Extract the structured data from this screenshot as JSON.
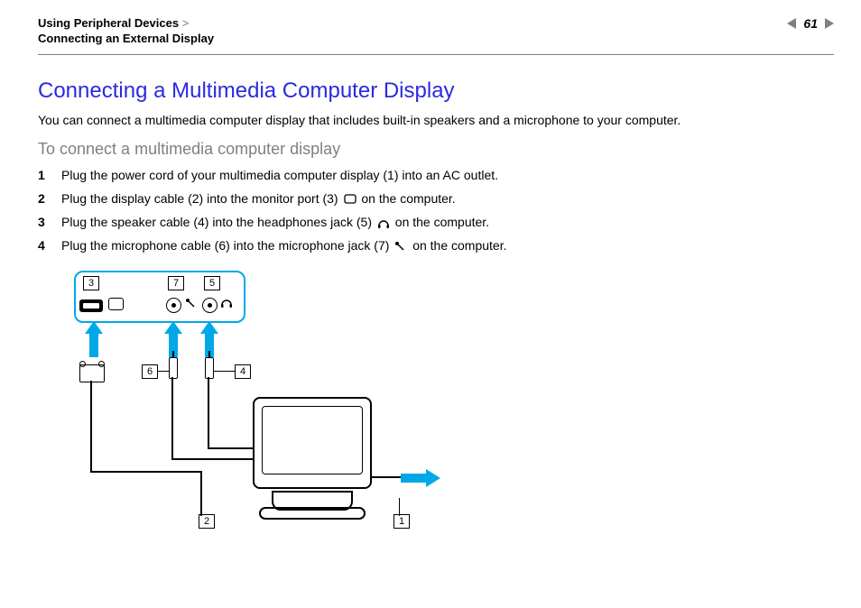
{
  "header": {
    "breadcrumb_top": "Using Peripheral Devices",
    "breadcrumb_sep": ">",
    "breadcrumb_sub": "Connecting an External Display",
    "page_number": "61"
  },
  "title": "Connecting a Multimedia Computer Display",
  "intro": "You can connect a multimedia computer display that includes built-in speakers and a microphone to your computer.",
  "subtitle": "To connect a multimedia computer display",
  "steps": [
    {
      "n": "1",
      "pre": "Plug the power cord of your multimedia computer display (1) into an AC outlet.",
      "icon": null,
      "post": ""
    },
    {
      "n": "2",
      "pre": "Plug the display cable (2) into the monitor port (3) ",
      "icon": "monitor",
      "post": " on the computer."
    },
    {
      "n": "3",
      "pre": "Plug the speaker cable (4) into the headphones jack (5) ",
      "icon": "headphones",
      "post": " on the computer."
    },
    {
      "n": "4",
      "pre": "Plug the microphone cable (6) into the microphone jack (7) ",
      "icon": "microphone",
      "post": " on the computer."
    }
  ],
  "callouts": {
    "b1": "1",
    "b2": "2",
    "b3": "3",
    "b4": "4",
    "b5": "5",
    "b6": "6",
    "b7": "7"
  }
}
